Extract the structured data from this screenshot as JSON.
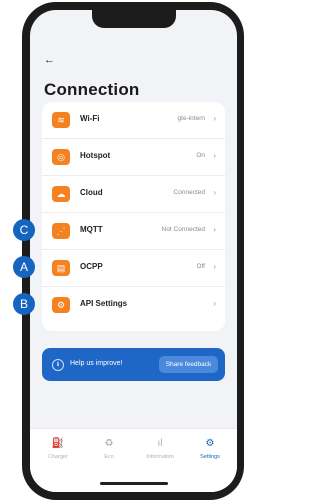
{
  "colors": {
    "accent": "#1565c0",
    "icon_orange": "#f58220",
    "banner": "#1f67c6"
  },
  "header": {
    "back_icon": "←",
    "title": "Connection"
  },
  "rows": [
    {
      "icon": "wifi-icon",
      "glyph": "≋",
      "label": "Wi-Fi",
      "value": "gte-intern"
    },
    {
      "icon": "hotspot-icon",
      "glyph": "◎",
      "label": "Hotspot",
      "value": "On"
    },
    {
      "icon": "cloud-icon",
      "glyph": "☁",
      "label": "Cloud",
      "value": "Connected"
    },
    {
      "icon": "mqtt-icon",
      "glyph": "⋰",
      "label": "MQTT",
      "value": "Not Connected"
    },
    {
      "icon": "ocpp-icon",
      "glyph": "▤",
      "label": "OCPP",
      "value": "Off"
    },
    {
      "icon": "api-settings-icon",
      "glyph": "⚙",
      "label": "API Settings",
      "value": ""
    }
  ],
  "chevron": "›",
  "annotations": {
    "c": "C",
    "a": "A",
    "b": "B"
  },
  "banner": {
    "icon": "ℹ",
    "text": "Help us improve!",
    "button": "Share feedback"
  },
  "tabs": [
    {
      "icon": "charger-icon",
      "glyph": "⛽",
      "label": "Charger"
    },
    {
      "icon": "eco-icon",
      "glyph": "♻",
      "label": "Eco"
    },
    {
      "icon": "information-icon",
      "glyph": "ıl",
      "label": "Information"
    },
    {
      "icon": "settings-icon",
      "glyph": "⚙",
      "label": "Settings"
    }
  ]
}
